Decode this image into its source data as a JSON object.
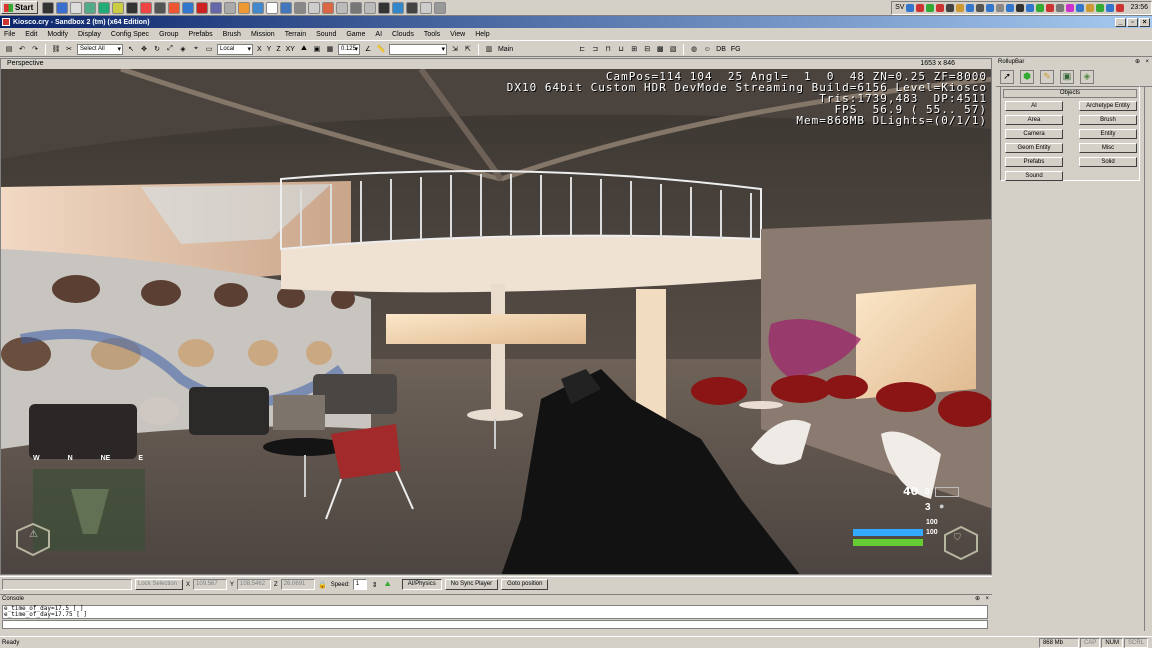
{
  "taskbar": {
    "start_label": "Start",
    "tray_label": "SV",
    "clock": "23:56"
  },
  "window": {
    "title": "Kiosco.cry - Sandbox 2 (tm) (x64 Edition)"
  },
  "menu": [
    "File",
    "Edit",
    "Modify",
    "Display",
    "Config Spec",
    "Group",
    "Prefabs",
    "Brush",
    "Mission",
    "Terrain",
    "Sound",
    "Game",
    "AI",
    "Clouds",
    "Tools",
    "View",
    "Help"
  ],
  "toolbar": {
    "select_filter": "Select All",
    "coord_system": "Local",
    "axis_x": "X",
    "axis_y": "Y",
    "axis_z": "Z",
    "axis_xy": "XY",
    "grid_size": "0.125",
    "layer_combo": "",
    "main_label": "Main"
  },
  "viewport": {
    "title": "Perspective",
    "resolution": "1653 x 846",
    "stats": "CamPos=114 104  25 Angl=  1  0  48 ZN=0.25 ZF=8000\nDX10 64bit Custom HDR DevMode Streaming Build=6156 Level=Kiosco\nTris:1739,483  DP:4511\nFPS  56.9 ( 55.. 57)\nMem=868MB DLights=(0/1/1)"
  },
  "hud": {
    "compass": [
      "W",
      "N",
      "NE",
      "E"
    ],
    "ammo_clip": "40",
    "ammo_reserve": "0",
    "grenades": "3",
    "energy": "100",
    "health": "100"
  },
  "rollup": {
    "title": "RollupBar",
    "panel_title": "Objects",
    "buttons": [
      "AI",
      "Archetype Entity",
      "Area",
      "Brush",
      "Camera",
      "Entity",
      "Geom Entity",
      "Misc",
      "Prefabs",
      "Solid",
      "Sound"
    ]
  },
  "statusbar": {
    "empty_field": "",
    "lock_selection": "Lock Selection",
    "x_label": "X",
    "x_value": "109.567",
    "y_label": "Y",
    "y_value": "108.5462",
    "z_label": "Z",
    "z_value": "26.0691",
    "speed_label": "Speed:",
    "speed_value": "1",
    "ai_physics": "AI/Physics",
    "sync_player": "No Sync Player",
    "goto_position": "Goto position"
  },
  "console": {
    "title": "Console",
    "lines": [
      "e_time_of_day=17.5 [ ]",
      "e_time_of_day=17.75 [ ]"
    ],
    "input": ""
  },
  "appstatus": {
    "ready": "Ready",
    "memory": "868 Mb",
    "cap": "CAP",
    "num": "NUM",
    "scrl": "SCRL"
  },
  "colors": {
    "title_gradient_start": "#0a246a",
    "title_gradient_end": "#a6caf0",
    "energy_bar": "#33aaff",
    "health_bar": "#66cc33"
  }
}
